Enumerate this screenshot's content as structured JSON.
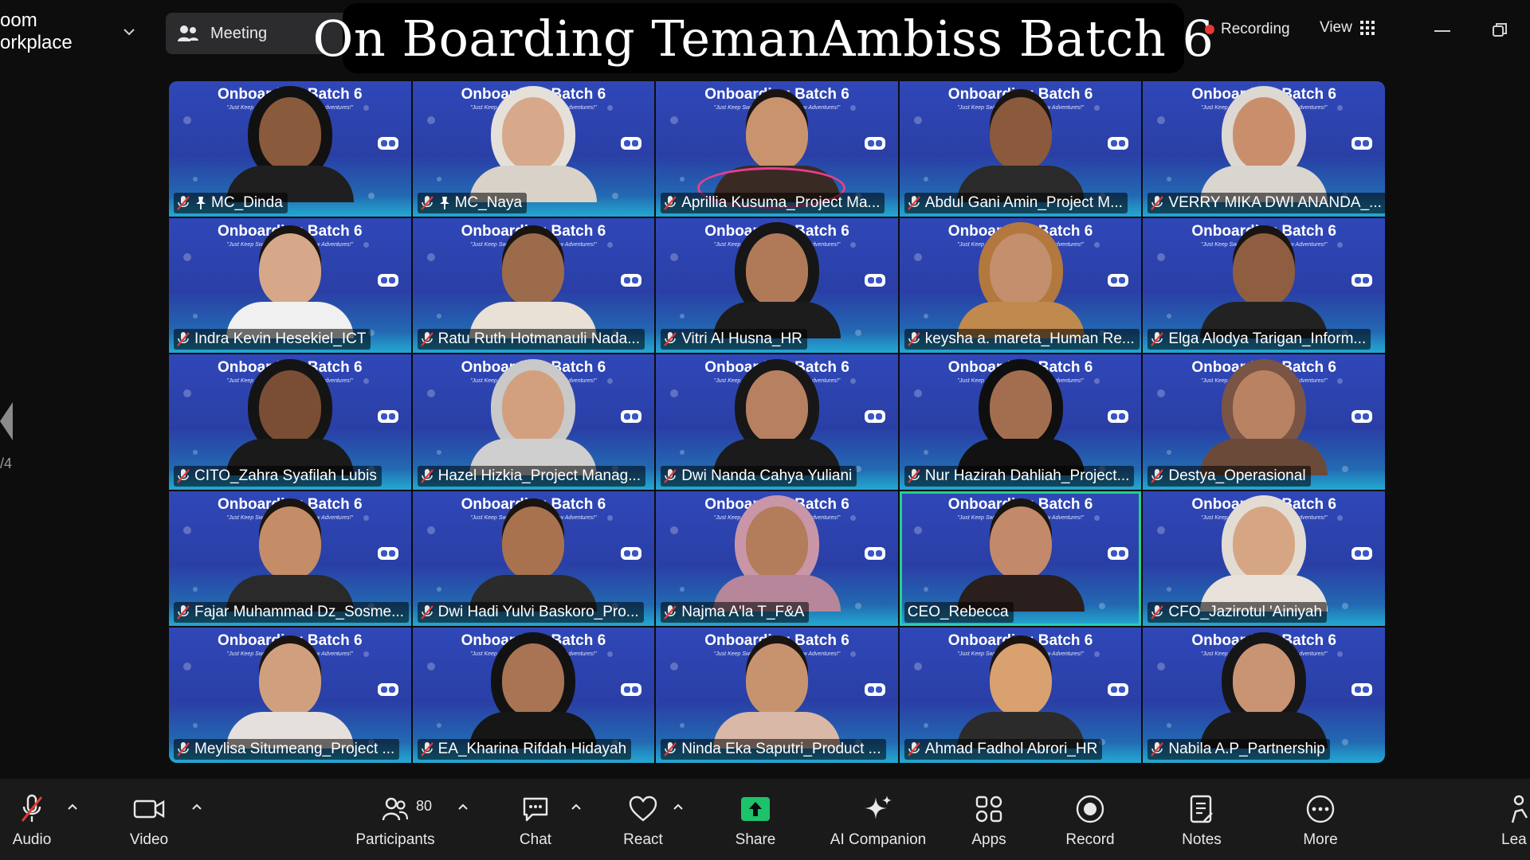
{
  "app": {
    "brand_line1": "oom",
    "brand_line2": "orkplace",
    "meeting_label": "Meeting"
  },
  "banner": {
    "title": "On Boarding TemanAmbiss Batch 6"
  },
  "status": {
    "recording": "Recording",
    "view": "View"
  },
  "paging": {
    "page": "/4"
  },
  "tile_bg": {
    "header": "Onboarding Batch 6",
    "subtitle": "\"Just Keep Swimming : Dive into New Adventures!\""
  },
  "participants": [
    {
      "name": "MC_Dinda",
      "muted": true,
      "pinned": true,
      "skin": "#8a5a3c",
      "shirt": "#1f1f1f",
      "hijab": "#111"
    },
    {
      "name": "MC_Naya",
      "muted": true,
      "pinned": true,
      "skin": "#d7a98a",
      "shirt": "#d9d2c8",
      "hijab": "#e6e0da"
    },
    {
      "name": "Aprillia Kusuma_Project Ma...",
      "muted": true,
      "pinned": false,
      "skin": "#c9936e",
      "shirt": "#3a2a24",
      "hijab": ""
    },
    {
      "name": "Abdul Gani Amin_Project M...",
      "muted": true,
      "pinned": false,
      "skin": "#8b5a3c",
      "shirt": "#2a2a2a",
      "hijab": ""
    },
    {
      "name": "VERRY MIKA DWI ANANDA_...",
      "muted": true,
      "pinned": false,
      "skin": "#c98f6c",
      "shirt": "#d9d6d0",
      "hijab": "#ddd8d2"
    },
    {
      "name": "Indra Kevin Hesekiel_ICT",
      "muted": true,
      "pinned": false,
      "skin": "#d6a889",
      "shirt": "#f0f0f0",
      "hijab": ""
    },
    {
      "name": "Ratu Ruth Hotmanauli Nada...",
      "muted": true,
      "pinned": false,
      "skin": "#9b6b4c",
      "shirt": "#e9e0d6",
      "hijab": ""
    },
    {
      "name": "Vitri Al Husna_HR",
      "muted": true,
      "pinned": false,
      "skin": "#b07a58",
      "shirt": "#1c1c1c",
      "hijab": "#161616"
    },
    {
      "name": "keysha a. mareta_Human Re...",
      "muted": true,
      "pinned": false,
      "skin": "#c48f6c",
      "shirt": "#c08a4e",
      "hijab": "#b2783e"
    },
    {
      "name": "Elga Alodya Tarigan_Inform...",
      "muted": true,
      "pinned": false,
      "skin": "#8f5e40",
      "shirt": "#222",
      "hijab": ""
    },
    {
      "name": "CITO_Zahra Syafilah Lubis",
      "muted": true,
      "pinned": false,
      "skin": "#7a4e34",
      "shirt": "#1a1a1a",
      "hijab": "#141414"
    },
    {
      "name": "Hazel Hizkia_Project Manag...",
      "muted": true,
      "pinned": false,
      "skin": "#d2a07e",
      "shirt": "#cfcfcf",
      "hijab": "#c9c9c9"
    },
    {
      "name": "Dwi Nanda Cahya Yuliani",
      "muted": true,
      "pinned": false,
      "skin": "#b68061",
      "shirt": "#1b1b1b",
      "hijab": "#171717"
    },
    {
      "name": "Nur Hazirah Dahliah_Project...",
      "muted": true,
      "pinned": false,
      "skin": "#a36e4f",
      "shirt": "#121212",
      "hijab": "#0f0f0f"
    },
    {
      "name": "Destya_Operasional",
      "muted": true,
      "pinned": false,
      "skin": "#b98262",
      "shirt": "#6b4a3a",
      "hijab": "#7a5444"
    },
    {
      "name": "Fajar Muhammad Dz_Sosme...",
      "muted": true,
      "pinned": false,
      "skin": "#c48d68",
      "shirt": "#2a2a2a",
      "hijab": ""
    },
    {
      "name": "Dwi Hadi Yulvi Baskoro_Pro...",
      "muted": true,
      "pinned": false,
      "skin": "#a8724f",
      "shirt": "#2b2b2b",
      "hijab": ""
    },
    {
      "name": "Najma A'la T_F&A",
      "muted": true,
      "pinned": false,
      "skin": "#b37c5a",
      "shirt": "#b7869a",
      "hijab": "#c996a8"
    },
    {
      "name": "CEO_Rebecca",
      "muted": false,
      "pinned": false,
      "skin": "#c2896a",
      "shirt": "#2a1f1c",
      "hijab": ""
    },
    {
      "name": "CFO_Jazirotul 'Ainiyah",
      "muted": true,
      "pinned": false,
      "skin": "#d6a684",
      "shirt": "#e9e2da",
      "hijab": "#e3dcd3"
    },
    {
      "name": "Meylisa Situmeang_Project ...",
      "muted": true,
      "pinned": false,
      "skin": "#d0a07e",
      "shirt": "#e6e0dc",
      "hijab": ""
    },
    {
      "name": "EA_Kharina Rifdah Hidayah",
      "muted": true,
      "pinned": false,
      "skin": "#a97454",
      "shirt": "#161616",
      "hijab": "#121212"
    },
    {
      "name": "Ninda Eka Saputri_Product ...",
      "muted": true,
      "pinned": false,
      "skin": "#c7936f",
      "shirt": "#d9b8a8",
      "hijab": ""
    },
    {
      "name": "Ahmad Fadhol Abrori_HR",
      "muted": true,
      "pinned": false,
      "skin": "#d9a070",
      "shirt": "#2b2b2b",
      "hijab": ""
    },
    {
      "name": "Nabila A.P_Partnership",
      "muted": true,
      "pinned": false,
      "skin": "#c99473",
      "shirt": "#1a1a1a",
      "hijab": "#161616"
    }
  ],
  "toolbar": {
    "audio": "Audio",
    "video": "Video",
    "participants": "Participants",
    "participants_count": "80",
    "chat": "Chat",
    "react": "React",
    "share": "Share",
    "ai_companion": "AI Companion",
    "apps": "Apps",
    "record": "Record",
    "notes": "Notes",
    "more": "More",
    "leave": "Lea"
  },
  "colors": {
    "share_green": "#1ec26b",
    "active_speaker": "#23d18b",
    "record_dot": "#e53935",
    "tile_blue": "#2f47b8"
  }
}
